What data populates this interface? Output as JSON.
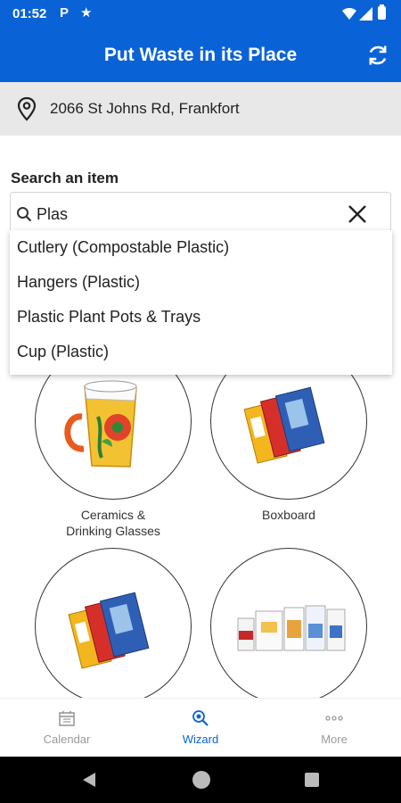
{
  "status_bar": {
    "time": "01:52",
    "notification_p": "P",
    "notification_star": "★"
  },
  "app_bar": {
    "title": "Put Waste in its Place"
  },
  "location": {
    "address": "2066 St Johns Rd, Frankfort"
  },
  "search": {
    "label": "Search an item",
    "value": "Plas",
    "suggestions": [
      "Cutlery (Compostable Plastic)",
      "Hangers (Plastic)",
      "Plastic Plant Pots & Trays",
      "Cup (Plastic)"
    ]
  },
  "categories": [
    {
      "label": "Ceramics &\nDrinking Glasses"
    },
    {
      "label": "Boxboard"
    },
    {
      "label": ""
    },
    {
      "label": ""
    }
  ],
  "bottom_nav": {
    "items": [
      {
        "label": "Calendar",
        "icon": "calendar-icon",
        "active": false
      },
      {
        "label": "Wizard",
        "icon": "wizard-search-icon",
        "active": true
      },
      {
        "label": "More",
        "icon": "more-dots-icon",
        "active": false
      }
    ]
  },
  "colors": {
    "primary": "#0a63d6",
    "location_bg": "#e8e8e8",
    "inactive_nav": "#9a9a9a"
  }
}
